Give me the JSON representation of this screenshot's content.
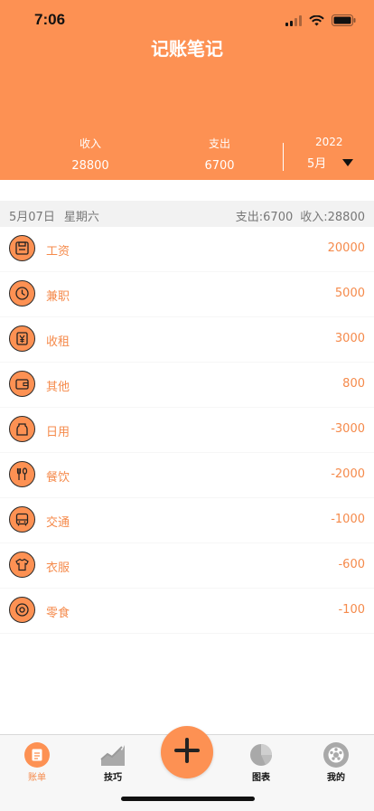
{
  "status_bar": {
    "time": "7:06"
  },
  "app_title": "记账笔记",
  "summary": {
    "income_label": "收入",
    "income_value": "28800",
    "expense_label": "支出",
    "expense_value": "6700",
    "year": "2022",
    "month": "5月"
  },
  "day_group": {
    "date": "5月07日",
    "weekday": "星期六",
    "expense_total": "支出:6700",
    "income_total": "收入:28800"
  },
  "entries": [
    {
      "icon": "salary-icon",
      "name": "工资",
      "amount": "20000"
    },
    {
      "icon": "clock-icon",
      "name": "兼职",
      "amount": "5000"
    },
    {
      "icon": "yen-icon",
      "name": "收租",
      "amount": "3000"
    },
    {
      "icon": "wallet-icon",
      "name": "其他",
      "amount": "800"
    },
    {
      "icon": "bottle-icon",
      "name": "日用",
      "amount": "-3000"
    },
    {
      "icon": "utensils-icon",
      "name": "餐饮",
      "amount": "-2000"
    },
    {
      "icon": "bus-icon",
      "name": "交通",
      "amount": "-1000"
    },
    {
      "icon": "shirt-icon",
      "name": "衣服",
      "amount": "-600"
    },
    {
      "icon": "donut-icon",
      "name": "零食",
      "amount": "-100"
    }
  ],
  "tabbar": {
    "tabs": [
      {
        "label": "账单",
        "icon": "bill-icon",
        "active": true
      },
      {
        "label": "技巧",
        "icon": "trend-icon",
        "active": false
      },
      {
        "label": "图表",
        "icon": "pie-chart-icon",
        "active": false
      },
      {
        "label": "我的",
        "icon": "profile-icon",
        "active": false
      }
    ]
  },
  "colors": {
    "accent": "#fd9153",
    "text_accent": "#f58a4b"
  }
}
